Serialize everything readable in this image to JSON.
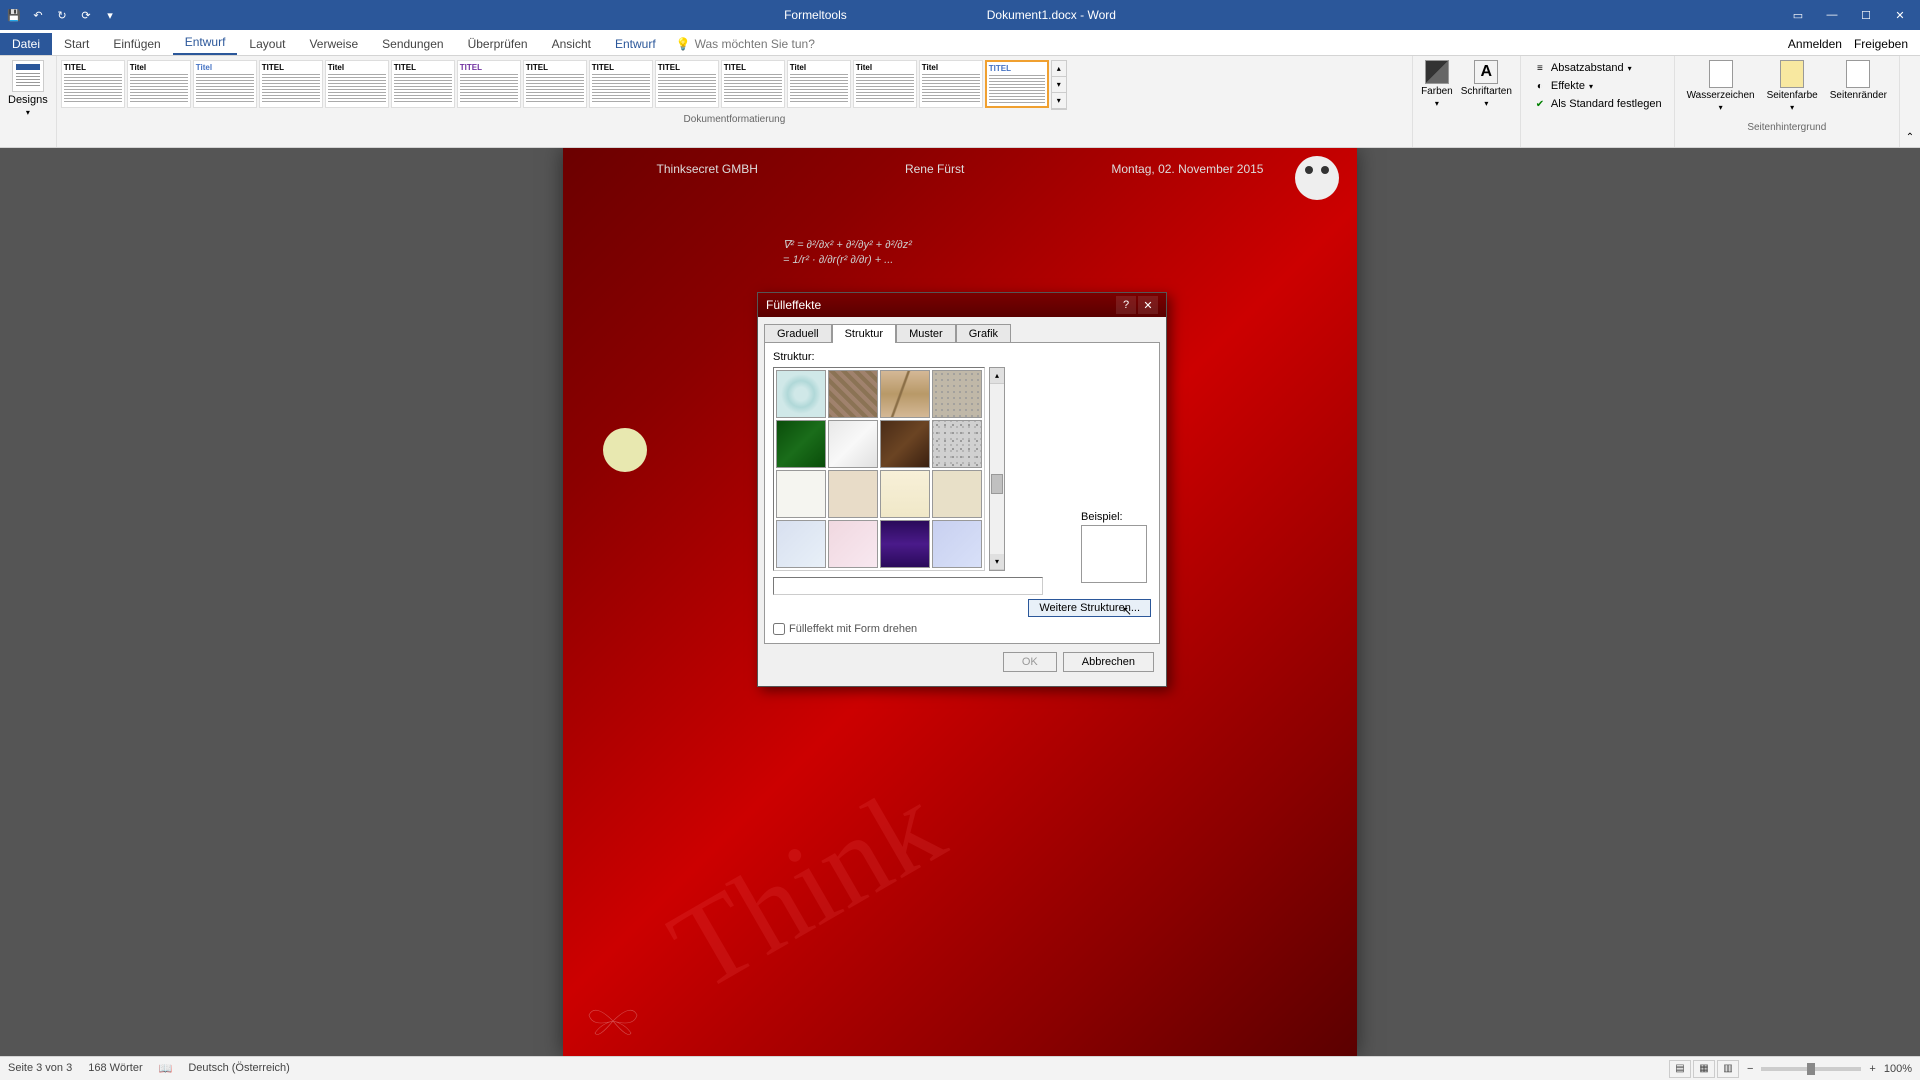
{
  "titlebar": {
    "formeltools": "Formeltools",
    "doc_title": "Dokument1.docx - Word"
  },
  "ribbon_tabs": {
    "datei": "Datei",
    "start": "Start",
    "einfuegen": "Einfügen",
    "entwurf": "Entwurf",
    "layout": "Layout",
    "verweise": "Verweise",
    "sendungen": "Sendungen",
    "ueberpruefen": "Überprüfen",
    "ansicht": "Ansicht",
    "entwurf2": "Entwurf",
    "tellme": "Was möchten Sie tun?",
    "anmelden": "Anmelden",
    "freigeben": "Freigeben"
  },
  "ribbon": {
    "designs_label": "Designs",
    "style_titles": [
      "TITEL",
      "Titel",
      "Titel",
      "TITEL",
      "Titel",
      "TITEL",
      "TITEL",
      "TITEL",
      "TITEL",
      "TITEL",
      "TITEL",
      "Titel",
      "Titel",
      "Titel",
      "TITEL"
    ],
    "dokumentformatierung": "Dokumentformatierung",
    "farben": "Farben",
    "schriftarten": "Schriftarten",
    "schriftarten_A": "A",
    "absatzabstand": "Absatzabstand",
    "effekte": "Effekte",
    "als_standard": "Als Standard festlegen",
    "wasserzeichen": "Wasserzeichen",
    "seitenfarbe": "Seitenfarbe",
    "seitenraender": "Seitenränder",
    "seitenhintergrund": "Seitenhintergrund"
  },
  "page": {
    "company": "Thinksecret GMBH",
    "author": "Rene Fürst",
    "date": "Montag, 02. November 2015",
    "formula1": "∇² = ∂²/∂x² + ∂²/∂y² + ∂²/∂z²",
    "formula2": "= 1/r² · ∂/∂r(r² ∂/∂r) + ...",
    "watermark": "Think"
  },
  "dialog": {
    "title": "Fülleffekte",
    "tabs": {
      "graduell": "Graduell",
      "struktur": "Struktur",
      "muster": "Muster",
      "grafik": "Grafik"
    },
    "struktur_label": "Struktur:",
    "beispiel": "Beispiel:",
    "more_textures": "Weitere Strukturen...",
    "rotate_check": "Fülleffekt mit Form drehen",
    "ok": "OK",
    "cancel": "Abbrechen"
  },
  "statusbar": {
    "page": "Seite 3 von 3",
    "words": "168 Wörter",
    "lang": "Deutsch (Österreich)",
    "zoom_minus": "−",
    "zoom_plus": "+",
    "zoom": "100%"
  }
}
